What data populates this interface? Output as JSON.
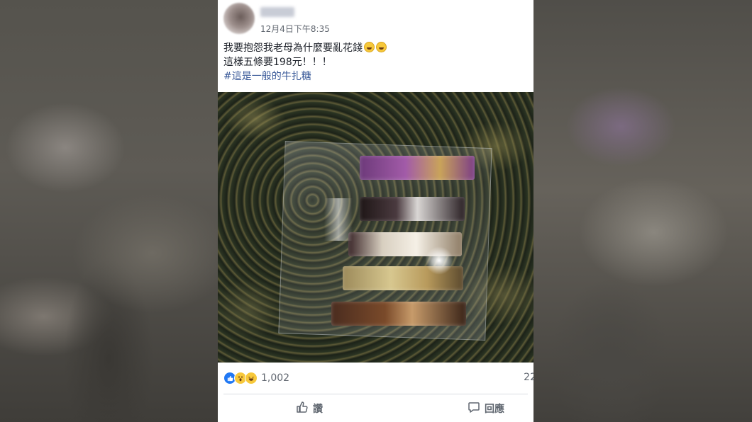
{
  "post": {
    "timestamp": "12月4日下午8:35",
    "text_line1": "我要抱怨我老母為什麼要亂花錢",
    "text_line2": "這樣五條要198元！！！",
    "hashtag": "#這是一般的牛扎糖",
    "reaction_count": "1,002",
    "comment_count": "22",
    "like_label": "讚",
    "comment_label": "回應"
  },
  "icons": {
    "like": "thumbs-up-icon",
    "comment": "comment-bubble-icon",
    "reactions": [
      "like-reaction-icon",
      "wow-reaction-icon",
      "haha-reaction-icon"
    ]
  },
  "colors": {
    "link": "#385898",
    "like_blue": "#2078f4",
    "reaction_yellow": "#f7c83a",
    "muted_text": "#616770"
  }
}
